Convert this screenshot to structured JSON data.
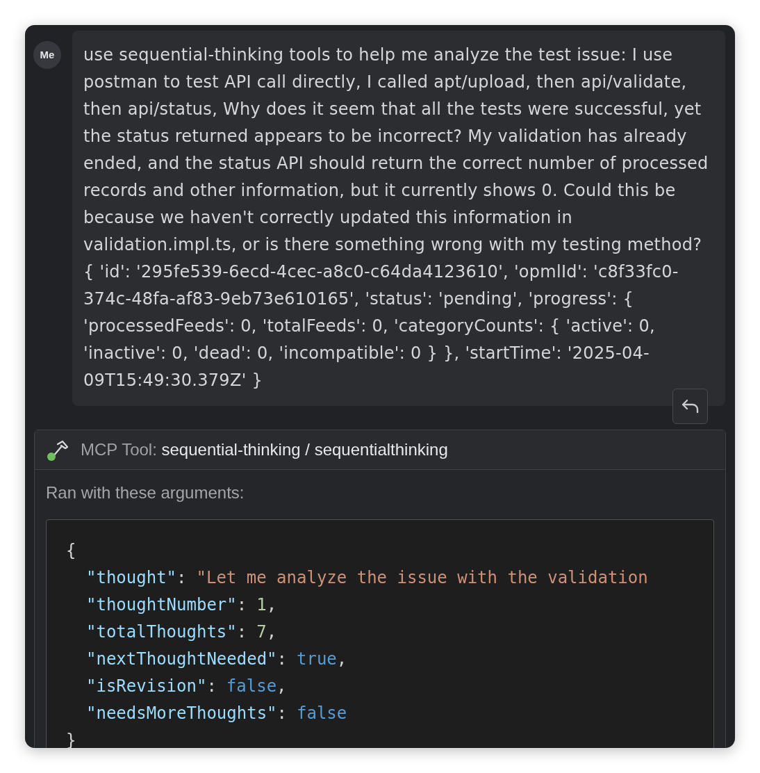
{
  "message": {
    "avatar": "Me",
    "text": "use sequential-thinking tools to help me analyze the test issue: I use postman to test API call directly, I called apt/upload, then api/validate, then api/status, Why does it seem that all the tests were successful, yet the status returned appears to be incorrect? My validation has already ended, and the status API should return the correct number of processed records and other information, but it currently shows 0. Could this be because we haven't correctly updated this information in validation.impl.ts, or is there something wrong with my testing method? { 'id': '295fe539-6ecd-4cec-a8c0-c64da4123610', 'opmlId': 'c8f33fc0-374c-48fa-af83-9eb73e610165', 'status': 'pending', 'progress': { 'processedFeeds': 0, 'totalFeeds': 0, 'categoryCounts': { 'active': 0, 'inactive': 0, 'dead': 0, 'incompatible': 0 } }, 'startTime': '2025-04-09T15:49:30.379Z' }"
  },
  "tool": {
    "label": "MCP Tool:",
    "name": "sequential-thinking / sequentialthinking",
    "arguments_label": "Ran with these arguments:",
    "code": {
      "open": "{",
      "close": "}",
      "entries": [
        {
          "key": "\"thought\"",
          "separator": ":",
          "value": "\"Let me analyze the issue with the validation",
          "kind": "string"
        },
        {
          "key": "\"thoughtNumber\"",
          "separator": ":",
          "value": "1",
          "kind": "number",
          "comma": ","
        },
        {
          "key": "\"totalThoughts\"",
          "separator": ":",
          "value": "7",
          "kind": "number",
          "comma": ","
        },
        {
          "key": "\"nextThoughtNeeded\"",
          "separator": ":",
          "value": "true",
          "kind": "keyword",
          "comma": ","
        },
        {
          "key": "\"isRevision\"",
          "separator": ":",
          "value": "false",
          "kind": "keyword",
          "comma": ","
        },
        {
          "key": "\"needsMoreThoughts\"",
          "separator": ":",
          "value": "false",
          "kind": "keyword"
        }
      ]
    }
  }
}
